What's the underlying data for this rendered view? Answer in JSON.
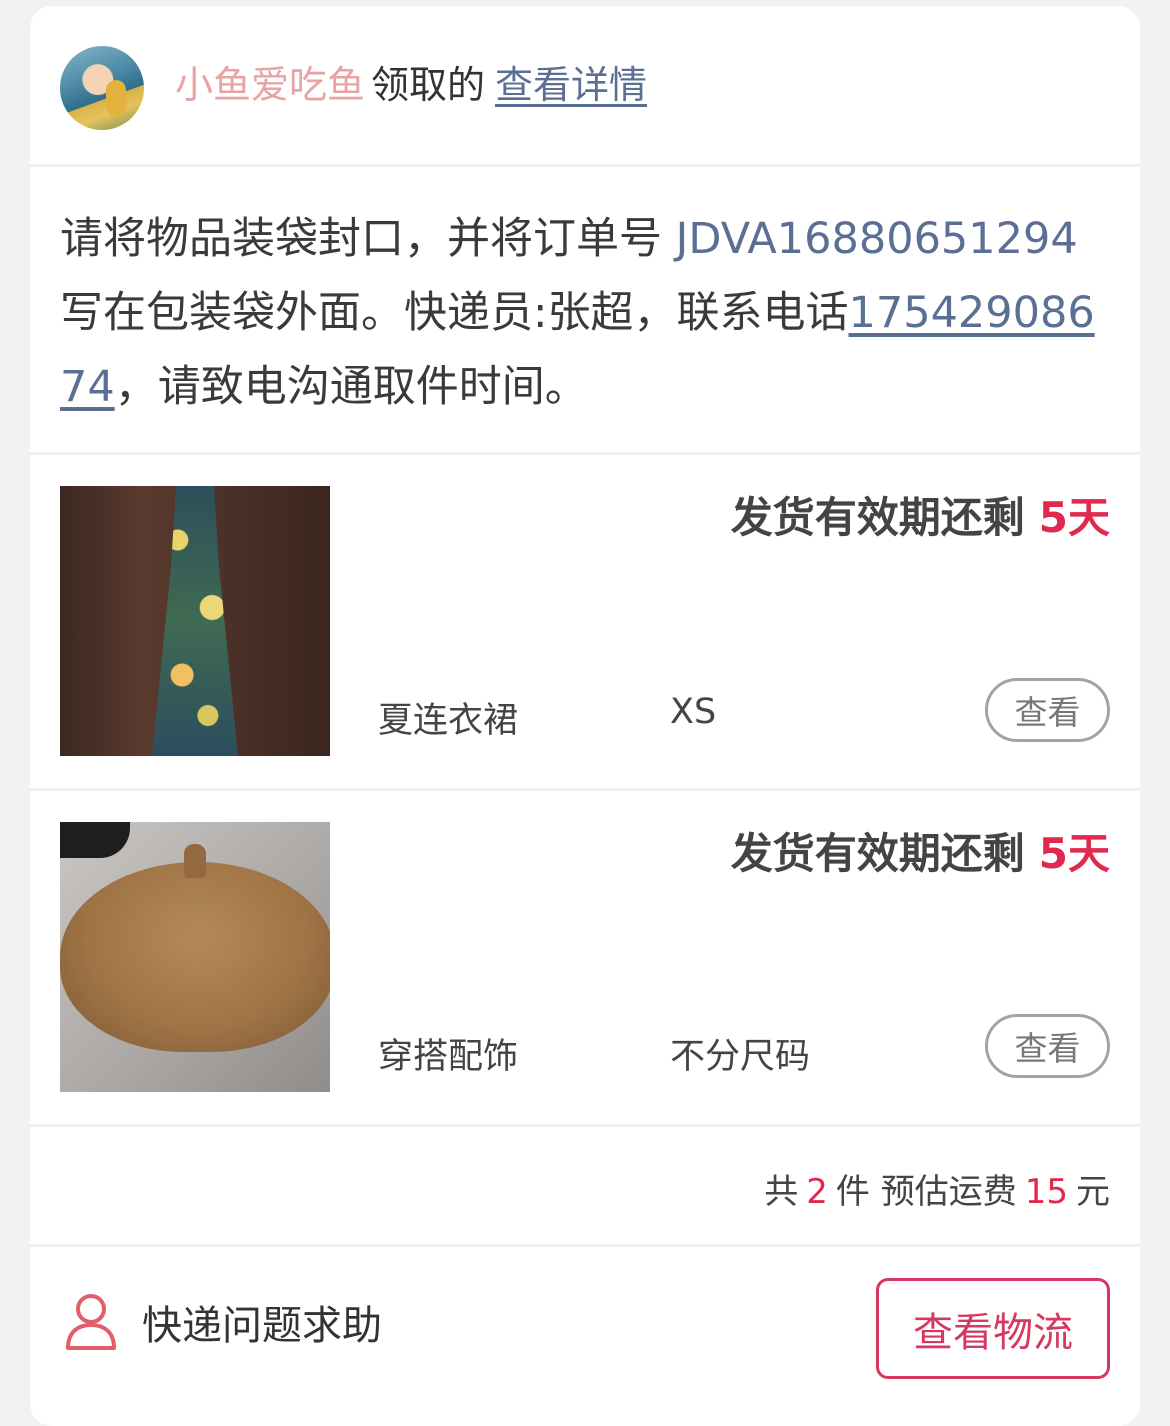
{
  "header": {
    "username": "小鱼爱吃鱼",
    "claimed_text": "领取的",
    "detail_link": "查看详情"
  },
  "instruction": {
    "text_before": "请将物品装袋封口，并将订单号 ",
    "order_number": "JDVA16880651294",
    "text_mid": " 写在包装袋外面。快递员:张超，联系电话",
    "phone": "17542908674",
    "text_after": "，请致电沟通取件时间。"
  },
  "items": [
    {
      "validity_label": "发货有效期还剩",
      "validity_days": "5天",
      "name": "夏连衣裙",
      "size": "XS",
      "view_label": "查看",
      "image_icon": "dress-photo"
    },
    {
      "validity_label": "发货有效期还剩",
      "validity_days": "5天",
      "name": "穿搭配饰",
      "size": "不分尺码",
      "view_label": "查看",
      "image_icon": "beret-photo"
    }
  ],
  "summary": {
    "prefix": "共",
    "count": "2",
    "count_unit": "件 预估运费",
    "fee": "15",
    "fee_unit": "元"
  },
  "footer": {
    "help_label": "快递问题求助",
    "help_icon": "person-icon",
    "logistics_label": "查看物流"
  },
  "colors": {
    "accent": "#e1284e",
    "link": "#5b6e94",
    "username": "#e8a3a5",
    "button_border": "#d63860"
  }
}
